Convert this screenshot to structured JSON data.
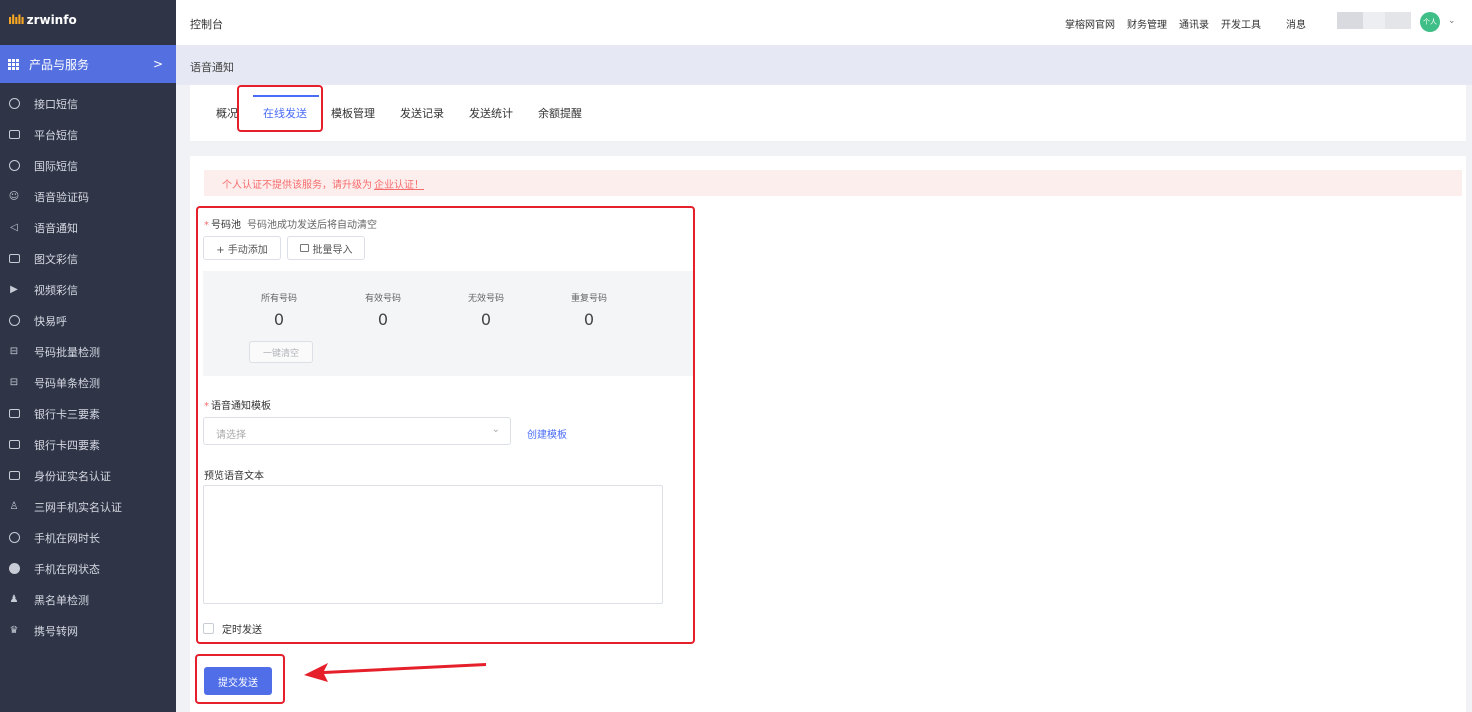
{
  "sidebar": {
    "brand": "zrwinfo",
    "brand_mark": "ılılı",
    "product_label": "产品与服务",
    "product_chevron": ">",
    "items": [
      {
        "label": "接口短信",
        "icon": "chat-bubble-icon"
      },
      {
        "label": "平台短信",
        "icon": "message-icon"
      },
      {
        "label": "国际短信",
        "icon": "globe-icon"
      },
      {
        "label": "语音验证码",
        "icon": "mic-icon"
      },
      {
        "label": "语音通知",
        "icon": "speaker-icon"
      },
      {
        "label": "图文彩信",
        "icon": "image-icon"
      },
      {
        "label": "视频彩信",
        "icon": "video-icon"
      },
      {
        "label": "快易呼",
        "icon": "phone-circle-icon"
      },
      {
        "label": "号码批量检测",
        "icon": "scan-icon"
      },
      {
        "label": "号码单条检测",
        "icon": "scan-single-icon"
      },
      {
        "label": "银行卡三要素",
        "icon": "card-icon"
      },
      {
        "label": "银行卡四要素",
        "icon": "card-four-icon"
      },
      {
        "label": "身份证实名认证",
        "icon": "id-card-icon"
      },
      {
        "label": "三网手机实名认证",
        "icon": "user-check-icon"
      },
      {
        "label": "手机在网时长",
        "icon": "clock-icon"
      },
      {
        "label": "手机在网状态",
        "icon": "status-dot-icon"
      },
      {
        "label": "黑名单检测",
        "icon": "blacklist-icon"
      },
      {
        "label": "携号转网",
        "icon": "transfer-icon"
      }
    ]
  },
  "topbar": {
    "title": "控制台",
    "links": [
      "掌榕网官网",
      "财务管理",
      "通讯录",
      "开发工具"
    ],
    "messages": "消息",
    "avatar_text": "个人",
    "avatar_chevron": "⌄"
  },
  "page": {
    "title": "语音通知"
  },
  "tabs": [
    {
      "label": "概况",
      "active": false
    },
    {
      "label": "在线发送",
      "active": true
    },
    {
      "label": "模板管理",
      "active": false
    },
    {
      "label": "发送记录",
      "active": false
    },
    {
      "label": "发送统计",
      "active": false
    },
    {
      "label": "余额提醒",
      "active": false
    }
  ],
  "alert": {
    "text": "个人认证不提供该服务，请升级为",
    "link": "企业认证！"
  },
  "form": {
    "pool_label": "号码池",
    "pool_hint": "号码池成功发送后将自动清空",
    "add_manual": "+ 手动添加",
    "batch_import": "批量导入",
    "stats": [
      {
        "label": "所有号码",
        "value": "0"
      },
      {
        "label": "有效号码",
        "value": "0"
      },
      {
        "label": "无效号码",
        "value": "0"
      },
      {
        "label": "重复号码",
        "value": "0"
      }
    ],
    "clear_all": "一键清空",
    "template_label": "语音通知模板",
    "template_placeholder": "请选择",
    "create_template": "创建模板",
    "preview_label": "预览语音文本",
    "preview_value": "",
    "schedule_label": "定时发送",
    "submit": "提交发送"
  },
  "colors": {
    "sidebar_bg": "#2f3447",
    "accent": "#4a6cf7",
    "annotation": "#e5202a",
    "alert_text": "#f56c6c"
  }
}
